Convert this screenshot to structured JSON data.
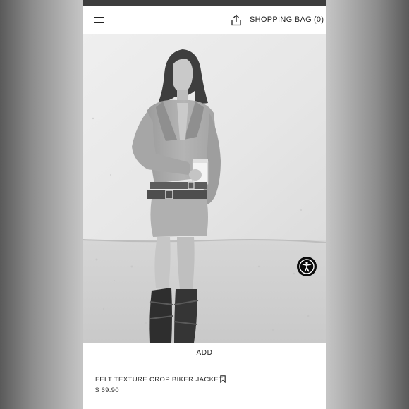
{
  "header": {
    "menu_icon": "hamburger-menu-icon",
    "share_icon": "share-upload-icon",
    "bag_label": "SHOPPING BAG",
    "bag_count": "(0)"
  },
  "product": {
    "image": "black-and-white-model-photo",
    "add_label": "ADD",
    "name": "FELT TEXTURE CROP BIKER JACKET",
    "price": "$ 69.90",
    "bookmark_icon": "bookmark-icon"
  },
  "accessibility": {
    "icon": "accessibility-person-icon"
  }
}
